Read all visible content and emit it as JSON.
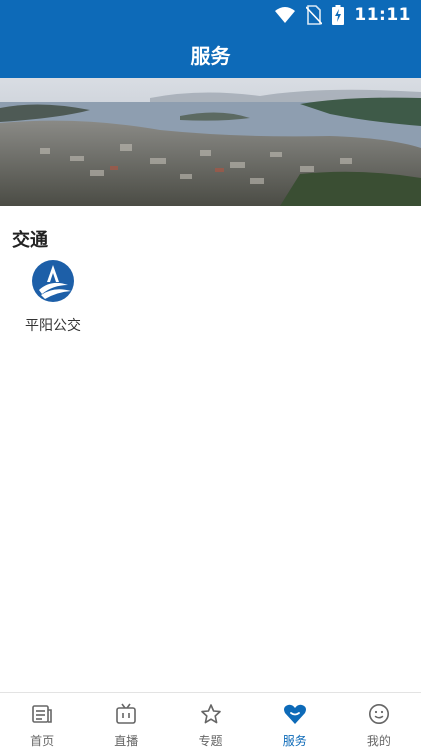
{
  "status_bar": {
    "time": "11:11",
    "icons": [
      "wifi-icon",
      "no-sim-icon",
      "battery-charging-icon"
    ]
  },
  "header": {
    "title": "服务"
  },
  "banner": {
    "image": "city-landscape-photo"
  },
  "sections": [
    {
      "title": "交通",
      "items": [
        {
          "label": "平阳公交",
          "icon": "pingyang-bus-logo-icon"
        }
      ]
    }
  ],
  "bottom_nav": {
    "items": [
      {
        "label": "首页",
        "icon": "news-icon"
      },
      {
        "label": "直播",
        "icon": "tv-icon"
      },
      {
        "label": "专题",
        "icon": "star-icon"
      },
      {
        "label": "服务",
        "icon": "heart-lips-icon",
        "active": true
      },
      {
        "label": "我的",
        "icon": "smiley-icon"
      }
    ]
  },
  "colors": {
    "primary": "#0d6ab8",
    "inactive": "#666666"
  }
}
